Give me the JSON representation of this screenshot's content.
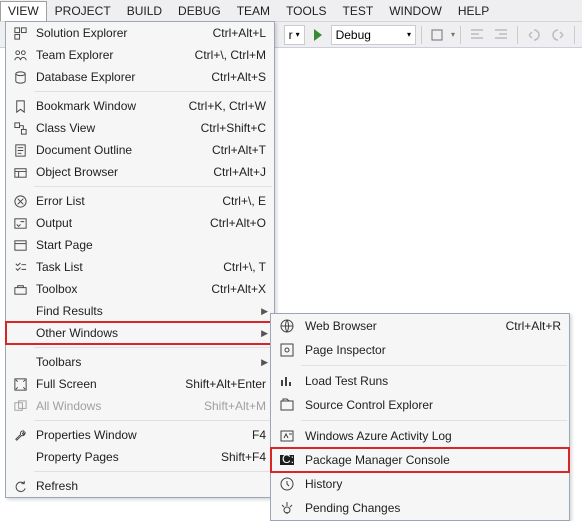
{
  "menubar": [
    "VIEW",
    "PROJECT",
    "BUILD",
    "DEBUG",
    "TEAM",
    "TOOLS",
    "TEST",
    "WINDOW",
    "HELP"
  ],
  "toolbar": {
    "combo1": "r",
    "combo2": "Debug"
  },
  "menu": {
    "items": [
      {
        "icon": "solution",
        "label": "Solution Explorer",
        "shortcut": "Ctrl+Alt+L"
      },
      {
        "icon": "team",
        "label": "Team Explorer",
        "shortcut": "Ctrl+\\, Ctrl+M"
      },
      {
        "icon": "database",
        "label": "Database Explorer",
        "shortcut": "Ctrl+Alt+S"
      },
      {
        "sep": true
      },
      {
        "icon": "bookmark",
        "label": "Bookmark Window",
        "shortcut": "Ctrl+K, Ctrl+W"
      },
      {
        "icon": "classview",
        "label": "Class View",
        "shortcut": "Ctrl+Shift+C"
      },
      {
        "icon": "docoutline",
        "label": "Document Outline",
        "shortcut": "Ctrl+Alt+T"
      },
      {
        "icon": "objbrowser",
        "label": "Object Browser",
        "shortcut": "Ctrl+Alt+J"
      },
      {
        "sep": true
      },
      {
        "icon": "errorlist",
        "label": "Error List",
        "shortcut": "Ctrl+\\, E"
      },
      {
        "icon": "output",
        "label": "Output",
        "shortcut": "Ctrl+Alt+O"
      },
      {
        "icon": "startpage",
        "label": "Start Page",
        "shortcut": ""
      },
      {
        "icon": "tasklist",
        "label": "Task List",
        "shortcut": "Ctrl+\\, T"
      },
      {
        "icon": "toolbox",
        "label": "Toolbox",
        "shortcut": "Ctrl+Alt+X"
      },
      {
        "icon": "",
        "label": "Find Results",
        "shortcut": "",
        "submenu": true
      },
      {
        "icon": "",
        "label": "Other Windows",
        "shortcut": "",
        "submenu": true,
        "highlight": true
      },
      {
        "sep": true
      },
      {
        "icon": "",
        "label": "Toolbars",
        "shortcut": "",
        "submenu": true
      },
      {
        "icon": "fullscreen",
        "label": "Full Screen",
        "shortcut": "Shift+Alt+Enter"
      },
      {
        "icon": "allwindows",
        "label": "All Windows",
        "shortcut": "Shift+Alt+M",
        "disabled": true
      },
      {
        "sep": true
      },
      {
        "icon": "wrench",
        "label": "Properties Window",
        "shortcut": "F4"
      },
      {
        "icon": "",
        "label": "Property Pages",
        "shortcut": "Shift+F4"
      },
      {
        "sep": true
      },
      {
        "icon": "refresh",
        "label": "Refresh",
        "shortcut": ""
      }
    ]
  },
  "submenu": {
    "items": [
      {
        "icon": "globe",
        "label": "Web Browser",
        "shortcut": "Ctrl+Alt+R"
      },
      {
        "icon": "inspector",
        "label": "Page Inspector",
        "shortcut": ""
      },
      {
        "sep": true
      },
      {
        "icon": "loadtest",
        "label": "Load Test Runs",
        "shortcut": ""
      },
      {
        "icon": "source",
        "label": "Source Control Explorer",
        "shortcut": ""
      },
      {
        "sep": true
      },
      {
        "icon": "azure",
        "label": "Windows Azure Activity Log",
        "shortcut": ""
      },
      {
        "icon": "console",
        "label": "Package Manager Console",
        "shortcut": "",
        "highlight": true
      },
      {
        "icon": "history",
        "label": "History",
        "shortcut": ""
      },
      {
        "icon": "pending",
        "label": "Pending Changes",
        "shortcut": ""
      }
    ]
  }
}
